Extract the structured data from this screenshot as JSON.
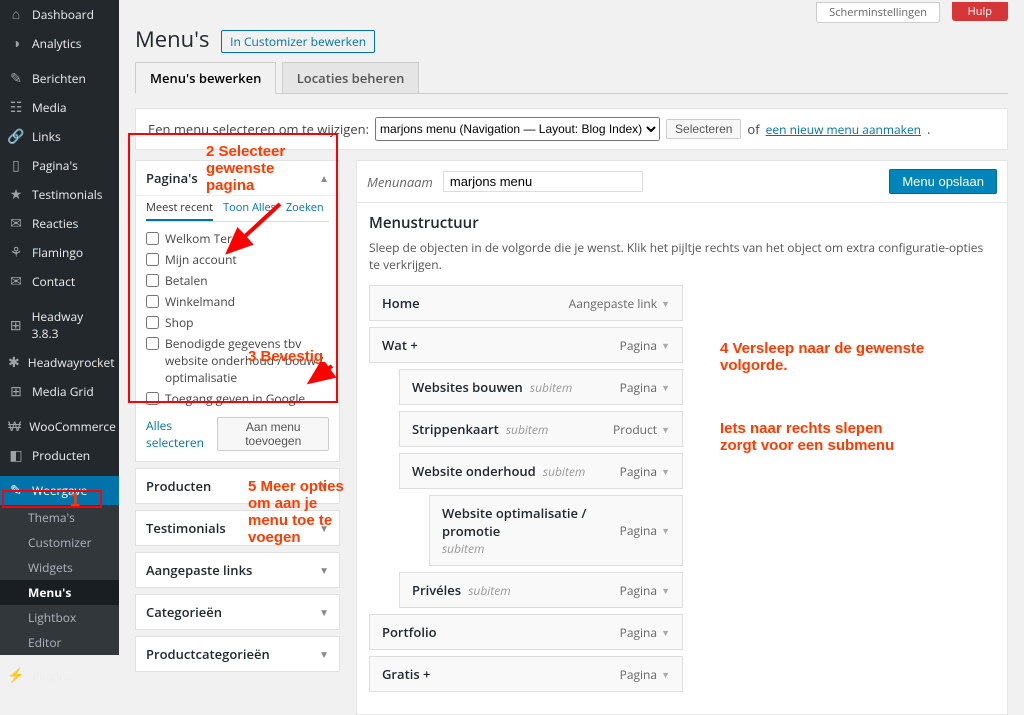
{
  "screen_options": "Scherminstellingen",
  "help": "Hulp",
  "page_title": "Menu's",
  "title_action": "In Customizer bewerken",
  "tabs": {
    "edit": "Menu's bewerken",
    "locations": "Locaties beheren"
  },
  "select_row": {
    "label": "Een menu selecteren om te wijzigen:",
    "selected": "marjons menu (Navigation — Layout: Blog Index)",
    "button": "Selecteren",
    "or": "of",
    "new_link": "een nieuw menu aanmaken"
  },
  "adminmenu": [
    {
      "icon": "⌂",
      "label": "Dashboard"
    },
    {
      "icon": "◑",
      "label": "Analytics"
    },
    {
      "sep": true
    },
    {
      "icon": "✎",
      "label": "Berichten"
    },
    {
      "icon": "☷",
      "label": "Media"
    },
    {
      "icon": "🔗",
      "label": "Links"
    },
    {
      "icon": "▯",
      "label": "Pagina's"
    },
    {
      "icon": "★",
      "label": "Testimonials"
    },
    {
      "icon": "✉",
      "label": "Reacties"
    },
    {
      "icon": "⚘",
      "label": "Flamingo"
    },
    {
      "icon": "✉",
      "label": "Contact"
    },
    {
      "sep": true
    },
    {
      "icon": "⊞",
      "label": "Headway 3.8.3"
    },
    {
      "icon": "✱",
      "label": "Headwayrocket"
    },
    {
      "icon": "⊞",
      "label": "Media Grid"
    },
    {
      "sep": true
    },
    {
      "icon": "₩",
      "label": "WooCommerce"
    },
    {
      "icon": "◧",
      "label": "Producten"
    },
    {
      "sep": true
    },
    {
      "icon": "✎",
      "label": "Weergave",
      "current": true
    }
  ],
  "weergave_sub": [
    "Thema's",
    "Customizer",
    "Widgets",
    "Menu's",
    "Lightbox",
    "Editor"
  ],
  "adminmenu_after": [
    {
      "icon": "⚡",
      "label": "Plugins"
    }
  ],
  "accordions": {
    "paginas": {
      "title": "Pagina's",
      "tabs": [
        "Meest recent",
        "Toon Alles",
        "Zoeken"
      ],
      "items": [
        "Welkom Terug",
        "Mijn account",
        "Betalen",
        "Winkelmand",
        "Shop",
        "Benodigde gegevens tbv website onderhoud / bouw / optimalisatie",
        "Toegang geven in Google"
      ],
      "select_all": "Alles selecteren",
      "add_btn": "Aan menu toevoegen"
    },
    "others": [
      "Producten",
      "Testimonials",
      "Aangepaste links",
      "Categorieën",
      "Productcategorieën"
    ]
  },
  "menu_name_label": "Menunaam",
  "menu_name_value": "marjons menu",
  "save_btn": "Menu opslaan",
  "structure_title": "Menustructuur",
  "structure_desc": "Sleep de objecten in de volgorde die je wenst. Klik het pijltje rechts van het object om extra configuratie-opties te verkrijgen.",
  "type_labels": {
    "link": "Aangepaste link",
    "page": "Pagina",
    "product": "Product"
  },
  "menu_items": [
    {
      "title": "Home",
      "type": "link",
      "depth": 0
    },
    {
      "title": "Wat +",
      "type": "page",
      "depth": 0
    },
    {
      "title": "Websites bouwen",
      "type": "page",
      "depth": 1,
      "sub": true
    },
    {
      "title": "Strippenkaart",
      "type": "product",
      "depth": 1,
      "sub": true
    },
    {
      "title": "Website onderhoud",
      "type": "page",
      "depth": 1,
      "sub": true
    },
    {
      "title": "Website optimalisatie / promotie",
      "type": "page",
      "depth": 2,
      "sub": true,
      "wrap": true
    },
    {
      "title": "Privéles",
      "type": "page",
      "depth": 1,
      "sub": true
    },
    {
      "title": "Portfolio",
      "type": "page",
      "depth": 0
    },
    {
      "title": "Gratis +",
      "type": "page",
      "depth": 0
    }
  ],
  "sub_label": "subitem",
  "anno": {
    "n1": "1",
    "n2": "2 Selecteer gewenste pagina",
    "n3": "3 Bevestig",
    "n4": "4 Versleep naar de gewenste volgorde.",
    "n4b": "Iets naar rechts slepen zorgt voor een submenu",
    "n5": "5 Meer opties om aan je menu toe te voegen"
  }
}
